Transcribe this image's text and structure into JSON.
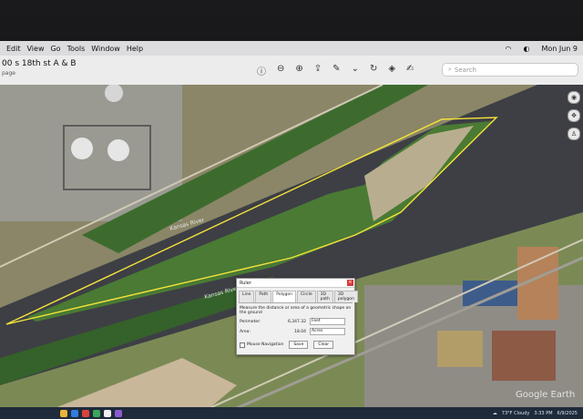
{
  "menubar": {
    "items": [
      "Edit",
      "View",
      "Go",
      "Tools",
      "Window",
      "Help"
    ],
    "clock": "Mon Jun 9"
  },
  "document": {
    "title": "00 s 18th st A & B",
    "subtitle": "page"
  },
  "search": {
    "placeholder": "Search"
  },
  "map": {
    "river_label_1": "Kansas River",
    "river_label_2": "Kansas River",
    "watermark": "Google Earth"
  },
  "ruler": {
    "title": "Ruler",
    "tabs": [
      "Line",
      "Path",
      "Polygon",
      "Circle",
      "3D path",
      "3D polygon"
    ],
    "active_tab": "Polygon",
    "description": "Measure the distance or area of a geometric shape on the ground",
    "perimeter_label": "Perimeter:",
    "perimeter_value": "6,347.32",
    "perimeter_unit": "Feet",
    "area_label": "Area:",
    "area_value": "18.04",
    "area_unit": "Acres",
    "mouse_nav_label": "Mouse Navigation",
    "save_label": "Save",
    "clear_label": "Clear"
  },
  "taskbar": {
    "weather": "73°F Cloudy",
    "time": "3:33 PM",
    "date": "6/9/2025"
  }
}
